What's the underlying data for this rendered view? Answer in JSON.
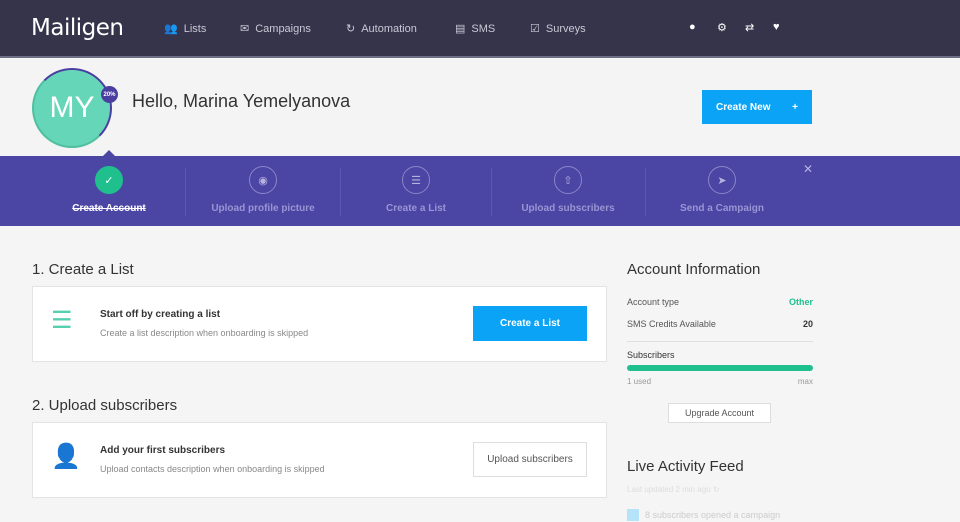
{
  "nav": {
    "logo": "Mailigen",
    "items": [
      {
        "label": "Lists",
        "icon": "users-icon"
      },
      {
        "label": "Campaigns",
        "icon": "envelope-icon"
      },
      {
        "label": "Automation",
        "icon": "refresh-icon"
      },
      {
        "label": "SMS",
        "icon": "chat-icon"
      },
      {
        "label": "Surveys",
        "icon": "checkbox-icon"
      }
    ]
  },
  "header": {
    "initials": "MY",
    "progress": "20%",
    "greeting": "Hello, Marina Yemelyanova",
    "create_new": "Create New",
    "plus": "+"
  },
  "steps": [
    {
      "label": "Create Account",
      "done": true
    },
    {
      "label": "Upload profile picture"
    },
    {
      "label": "Create a List"
    },
    {
      "label": "Upload subscribers"
    },
    {
      "label": "Send a Campaign"
    }
  ],
  "sections": [
    {
      "title": "1. Create a List",
      "card_title": "Start off by creating a list",
      "card_desc": "Create a list description when onboarding is skipped",
      "button": "Create a List"
    },
    {
      "title": "2. Upload subscribers",
      "card_title": "Add your first subscribers",
      "card_desc": "Upload contacts description when onboarding is skipped",
      "button": "Upload subscribers"
    }
  ],
  "account": {
    "title": "Account Information",
    "type_label": "Account type",
    "type_value": "Other",
    "sms_label": "SMS Credits Available",
    "sms_value": "20",
    "subs_label": "Subscribers",
    "subs_used": "1 used",
    "subs_max": "max",
    "subs_fill": 1.0,
    "upgrade": "Upgrade Account"
  },
  "feed": {
    "title": "Live Activity Feed",
    "updated": "Last updated 2 min ago",
    "items": [
      "8 subscribers opened a campaign"
    ]
  },
  "colors": {
    "nav": "#35344a",
    "steps": "#4b45a4",
    "accent": "#0aa3f5",
    "green": "#1fc08e"
  }
}
